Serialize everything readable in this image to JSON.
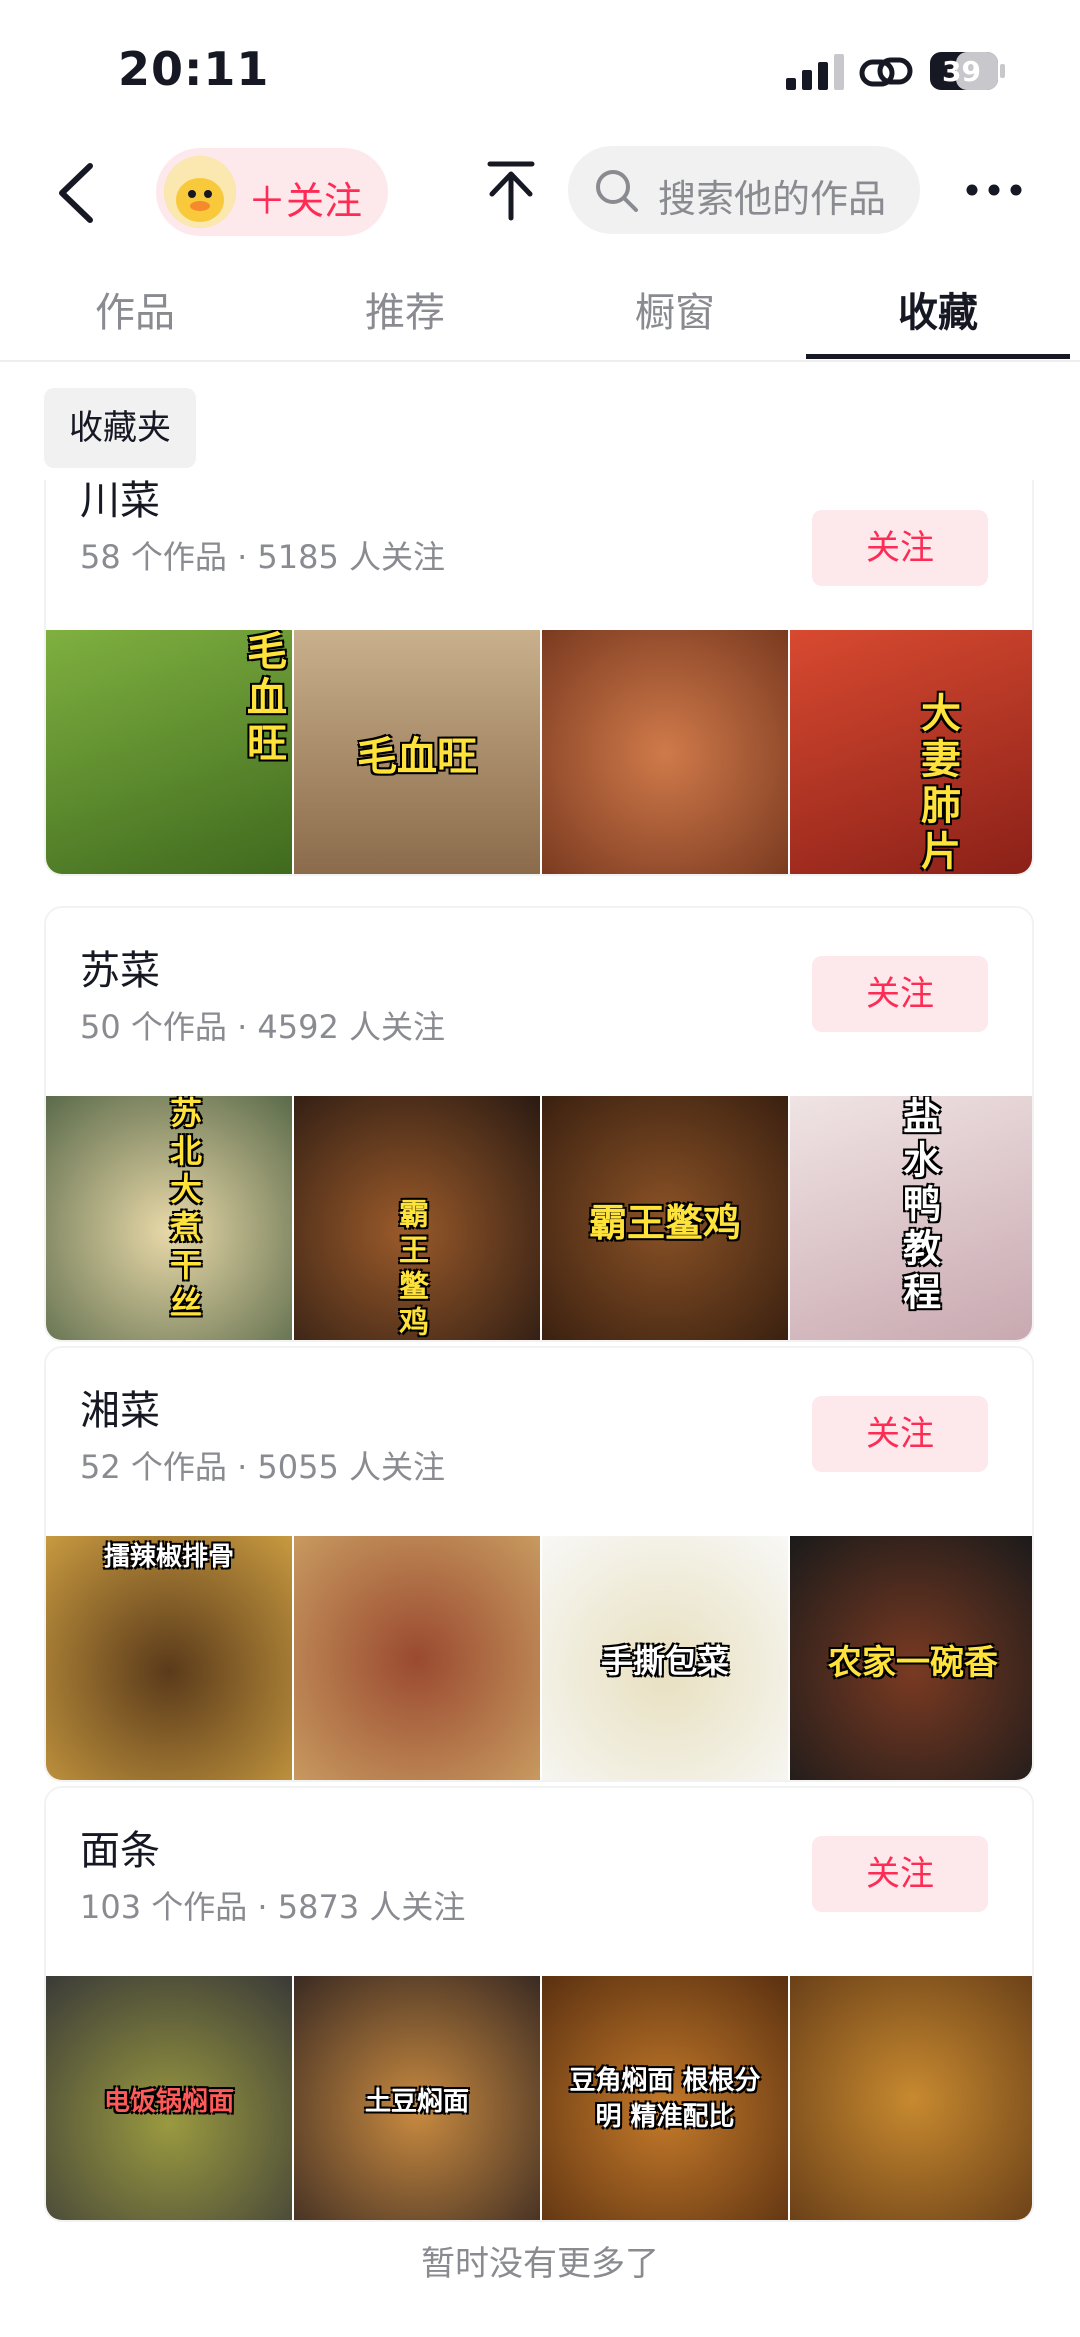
{
  "status_bar": {
    "time": "20:11",
    "battery": "39"
  },
  "nav": {
    "follow_label": "＋关注",
    "search_placeholder": "搜索他的作品"
  },
  "tabs": [
    {
      "label": "作品"
    },
    {
      "label": "推荐"
    },
    {
      "label": "橱窗"
    },
    {
      "label": "收藏"
    }
  ],
  "folder_chip": "收藏夹",
  "collections": [
    {
      "title": "川菜",
      "meta": "58 个作品 · 5185 人关注",
      "follow_label": "关注",
      "thumbs": [
        {
          "caption": "毛血旺",
          "style": "yellow-vertical",
          "bg": "#5d8a2a"
        },
        {
          "caption": "毛血旺",
          "style": "yellow",
          "bg": "#b89a78"
        },
        {
          "caption": "",
          "style": "",
          "bg": "#a6583a"
        },
        {
          "caption": "大妻肺片",
          "style": "yellow-vertical",
          "bg": "#c13824"
        }
      ]
    },
    {
      "title": "苏菜",
      "meta": "50 个作品 · 4592 人关注",
      "follow_label": "关注",
      "thumbs": [
        {
          "caption": "苏北大煮干丝",
          "style": "yellow-vertical",
          "bg": "#7a8a6a"
        },
        {
          "caption": "霸王鳖鸡",
          "style": "yellow-vertical",
          "bg": "#5a3a22"
        },
        {
          "caption": "霸王鳖鸡",
          "style": "yellow",
          "bg": "#6b4020"
        },
        {
          "caption": "盐水鸭教程",
          "style": "white-vertical",
          "bg": "#d8c0c0"
        }
      ]
    },
    {
      "title": "湘菜",
      "meta": "52 个作品 · 5055 人关注",
      "follow_label": "关注",
      "thumbs": [
        {
          "caption": "擂辣椒排骨",
          "style": "white-top",
          "bg": "#4a3418"
        },
        {
          "caption": "",
          "style": "",
          "bg": "#7a4a30"
        },
        {
          "caption": "手撕包菜",
          "style": "white",
          "bg": "#e6e0cc"
        },
        {
          "caption": "农家一碗香",
          "style": "yellow",
          "bg": "#3a2a22"
        }
      ]
    },
    {
      "title": "面条",
      "meta": "103 个作品 · 5873 人关注",
      "follow_label": "关注",
      "thumbs": [
        {
          "caption": "电饭锅焖面",
          "style": "white-small",
          "bg": "#5a5a52"
        },
        {
          "caption": "土豆焖面",
          "style": "white-small",
          "bg": "#7a5030"
        },
        {
          "caption": "豆角焖面 根根分明 精准配比",
          "style": "white-small",
          "bg": "#8a5428"
        },
        {
          "caption": "",
          "style": "",
          "bg": "#9a6a2a"
        }
      ]
    }
  ],
  "footer_note": "暂时没有更多了",
  "colors": {
    "accent": "#fe2c55",
    "accent_bg": "#fde8ec",
    "muted": "#8a8b91"
  },
  "icons": [
    "signal-icon",
    "link-icon",
    "battery-icon",
    "back-arrow-icon",
    "duck-avatar-icon",
    "share-upload-icon",
    "search-icon",
    "more-dots-icon"
  ]
}
